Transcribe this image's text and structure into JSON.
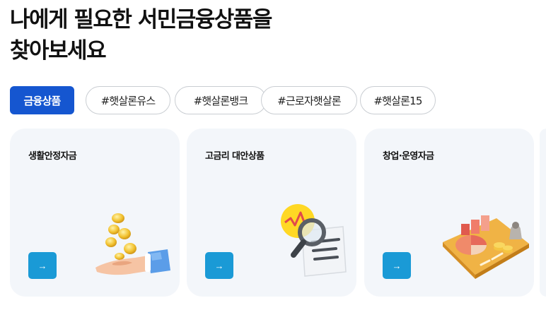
{
  "heading": {
    "line1": "나에게 필요한 서민금융상품을",
    "line2": "찾아보세요"
  },
  "chips": [
    {
      "label": "금융상품",
      "active": true
    },
    {
      "label": "#햇살론유스",
      "active": false
    },
    {
      "label": "#햇살론뱅크",
      "active": false
    },
    {
      "label": "#근로자햇살론",
      "active": false
    },
    {
      "label": "#햇살론15",
      "active": false
    }
  ],
  "cards": [
    {
      "title": "생활안정자금",
      "icon": "coins-hand-icon",
      "button_glyph": "→"
    },
    {
      "title": "고금리 대안상품",
      "icon": "magnifier-document-icon",
      "button_glyph": "→"
    },
    {
      "title": "창업·운영자금",
      "icon": "business-chart-icon",
      "button_glyph": "→"
    }
  ],
  "colors": {
    "primary": "#1556d0",
    "arrow_button": "#1a9ad6",
    "card_bg": "#f3f6fa",
    "chip_border": "#c9cdd2"
  }
}
